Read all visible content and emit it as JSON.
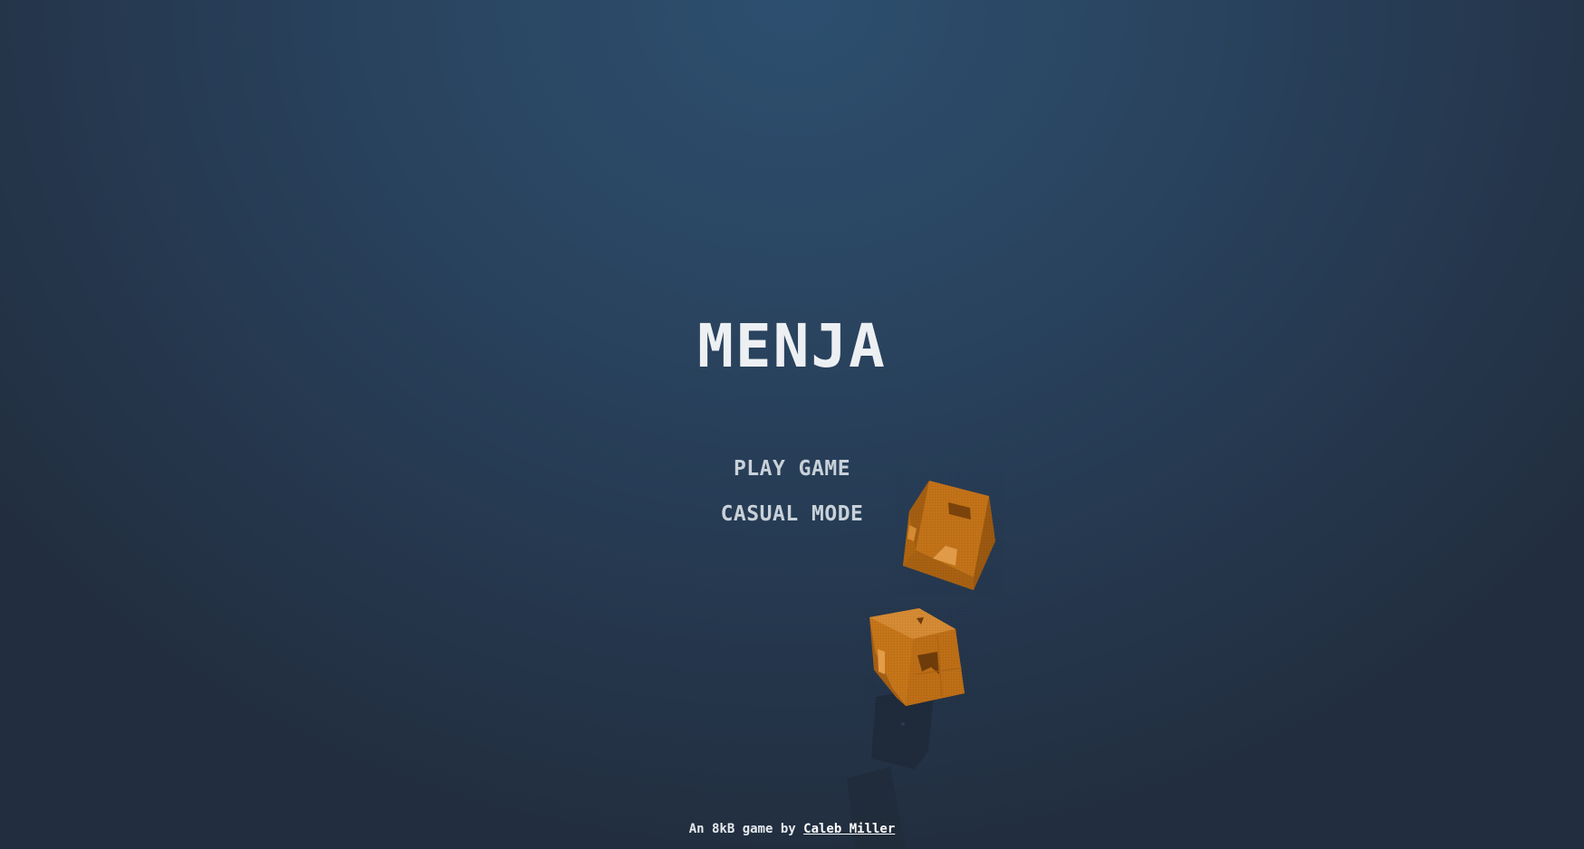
{
  "game": {
    "title": "MENJA"
  },
  "menu": {
    "items": [
      {
        "label": "PLAY GAME"
      },
      {
        "label": "CASUAL MODE"
      }
    ]
  },
  "credits": {
    "prefix": "An 8kB game by ",
    "author": "Caleb Miller"
  },
  "colors": {
    "background_center": "#2d4f6f",
    "background_edge": "#222e3f",
    "cube_orange": "#c8761c",
    "title_text": "#edf0f3",
    "menu_text": "#c9d1d9"
  }
}
